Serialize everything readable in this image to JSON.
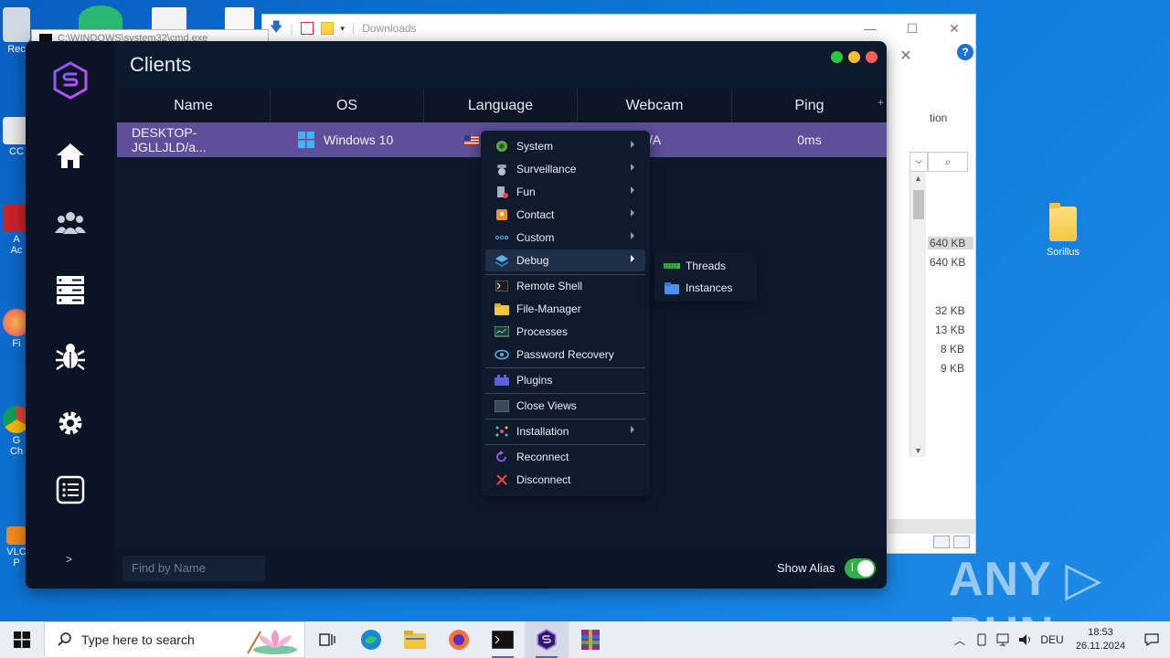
{
  "desktop": {
    "folder_label": "Sorillus",
    "watermark": "ANY ▷ RUN",
    "left_icon_labels": [
      "Rec",
      "CC",
      "A",
      "Ac",
      "Fi",
      "G",
      "Ch",
      "VLC",
      "P"
    ]
  },
  "cmd_window": {
    "title": "C:\\WINDOWS\\system32\\cmd.exe"
  },
  "explorer": {
    "breadcrumb": "Downloads",
    "controls": [
      "—",
      "☐",
      "✕"
    ],
    "partial_text": "tion",
    "sizes": [
      "640 KB",
      "640 KB",
      "32 KB",
      "13 KB",
      "8 KB",
      "9 KB"
    ]
  },
  "app": {
    "title": "Clients",
    "window_dot_colors": [
      "#28c840",
      "#febc2e",
      "#ff5f57"
    ],
    "accent": "#5d4f99",
    "nav_icons": [
      "home-icon",
      "users-icon",
      "server-icon",
      "bug-icon",
      "gear-icon",
      "list-icon"
    ],
    "expand_label": ">",
    "grid": {
      "columns": [
        "Name",
        "OS",
        "Language",
        "Webcam",
        "Ping"
      ],
      "rows": [
        {
          "name": "DESKTOP-JGLLJLD/a...",
          "os": "Windows 10",
          "language": "",
          "webcam": "/A",
          "ping": "0ms"
        }
      ]
    },
    "footer": {
      "search_placeholder": "Find by Name",
      "alias_label": "Show Alias",
      "alias_on": true
    }
  },
  "context_menu": {
    "items": [
      {
        "label": "System",
        "submenu": true
      },
      {
        "label": "Surveillance",
        "submenu": true
      },
      {
        "label": "Fun",
        "submenu": true
      },
      {
        "label": "Contact",
        "submenu": true
      },
      {
        "label": "Custom",
        "submenu": true
      },
      {
        "label": "Debug",
        "submenu": true,
        "active": true
      },
      {
        "label": "Remote Shell",
        "submenu": false
      },
      {
        "label": "File-Manager",
        "submenu": false
      },
      {
        "label": "Processes",
        "submenu": false
      },
      {
        "label": "Password Recovery",
        "submenu": false
      },
      {
        "label": "Plugins",
        "submenu": false
      },
      {
        "label": "Close Views",
        "submenu": false
      },
      {
        "label": "Installation",
        "submenu": true
      },
      {
        "label": "Reconnect",
        "submenu": false
      },
      {
        "label": "Disconnect",
        "submenu": false
      }
    ],
    "debug_submenu": [
      {
        "label": "Threads"
      },
      {
        "label": "Instances"
      }
    ]
  },
  "taskbar": {
    "search_placeholder": "Type here to search",
    "language": "DEU",
    "time": "18:53",
    "date": "26.11.2024"
  }
}
